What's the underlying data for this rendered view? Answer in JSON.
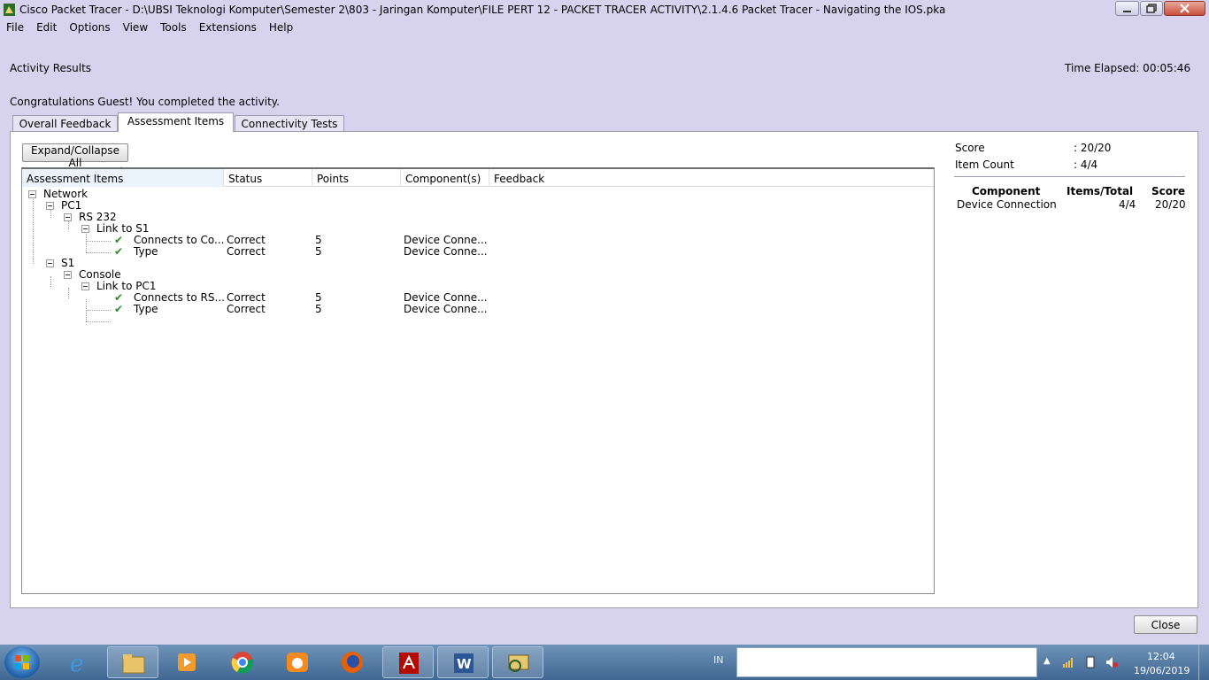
{
  "window": {
    "title": "Cisco Packet Tracer - D:\\UBSI Teknologi Komputer\\Semester 2\\803 - Jaringan Komputer\\FILE PERT 12 - PACKET TRACER ACTIVITY\\2.1.4.6 Packet Tracer - Navigating the IOS.pka"
  },
  "menu": [
    "File",
    "Edit",
    "Options",
    "View",
    "Tools",
    "Extensions",
    "Help"
  ],
  "header": {
    "activity_results": "Activity Results",
    "time_elapsed": "Time Elapsed: 00:05:46",
    "congrats": "Congratulations Guest! You completed the activity."
  },
  "tabs": [
    "Overall Feedback",
    "Assessment Items",
    "Connectivity Tests"
  ],
  "active_tab": "Assessment Items",
  "expand_button": "Expand/Collapse All",
  "columns": [
    "Assessment Items",
    "Status",
    "Points",
    "Component(s)",
    "Feedback"
  ],
  "tree": [
    {
      "label": "Network",
      "status": "",
      "points": "",
      "component": "",
      "check": false
    },
    {
      "label": "PC1",
      "status": "",
      "points": "",
      "component": "",
      "check": false
    },
    {
      "label": "RS 232",
      "status": "",
      "points": "",
      "component": "",
      "check": false
    },
    {
      "label": "Link to S1",
      "status": "",
      "points": "",
      "component": "",
      "check": false
    },
    {
      "label": "Connects to Co...",
      "status": "Correct",
      "points": "5",
      "component": "Device Conne...",
      "check": true
    },
    {
      "label": "Type",
      "status": "Correct",
      "points": "5",
      "component": "Device Conne...",
      "check": true
    },
    {
      "label": "S1",
      "status": "",
      "points": "",
      "component": "",
      "check": false
    },
    {
      "label": "Console",
      "status": "",
      "points": "",
      "component": "",
      "check": false
    },
    {
      "label": "Link to PC1",
      "status": "",
      "points": "",
      "component": "",
      "check": false
    },
    {
      "label": "Connects to RS...",
      "status": "Correct",
      "points": "5",
      "component": "Device Conne...",
      "check": true
    },
    {
      "label": "Type",
      "status": "Correct",
      "points": "5",
      "component": "Device Conne...",
      "check": true
    }
  ],
  "summary": {
    "score_label": "Score",
    "score_value": ": 20/20",
    "count_label": "Item Count",
    "count_value": ": 4/4",
    "table_headers": [
      "Component",
      "Items/Total",
      "Score"
    ],
    "rows": [
      {
        "component": "Device Connection",
        "items_total": "4/4",
        "score": "20/20"
      }
    ]
  },
  "close_button": "Close",
  "taskbar": {
    "apps": [
      "start",
      "internet-explorer-icon",
      "file-explorer-icon",
      "media-player-icon",
      "chrome-icon",
      "uc-browser-icon",
      "firefox-icon",
      "acrobat-icon",
      "word-icon",
      "packet-tracer-icon"
    ],
    "language": "IN",
    "time": "12:04",
    "date": "19/06/2019"
  },
  "colors": {
    "window_bg": "#d7d3ef",
    "check_green": "#2c8a24",
    "taskbar": "#4a7099"
  }
}
